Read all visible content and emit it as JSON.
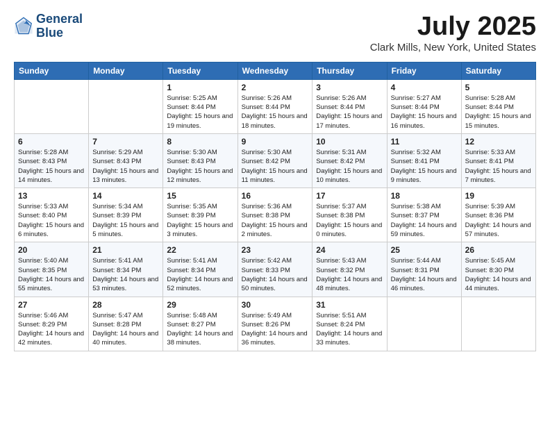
{
  "header": {
    "logo_line1": "General",
    "logo_line2": "Blue",
    "month_title": "July 2025",
    "location": "Clark Mills, New York, United States"
  },
  "weekdays": [
    "Sunday",
    "Monday",
    "Tuesday",
    "Wednesday",
    "Thursday",
    "Friday",
    "Saturday"
  ],
  "weeks": [
    [
      null,
      null,
      {
        "day": "1",
        "sunrise": "5:25 AM",
        "sunset": "8:44 PM",
        "daylight": "15 hours and 19 minutes."
      },
      {
        "day": "2",
        "sunrise": "5:26 AM",
        "sunset": "8:44 PM",
        "daylight": "15 hours and 18 minutes."
      },
      {
        "day": "3",
        "sunrise": "5:26 AM",
        "sunset": "8:44 PM",
        "daylight": "15 hours and 17 minutes."
      },
      {
        "day": "4",
        "sunrise": "5:27 AM",
        "sunset": "8:44 PM",
        "daylight": "15 hours and 16 minutes."
      },
      {
        "day": "5",
        "sunrise": "5:28 AM",
        "sunset": "8:44 PM",
        "daylight": "15 hours and 15 minutes."
      }
    ],
    [
      {
        "day": "6",
        "sunrise": "5:28 AM",
        "sunset": "8:43 PM",
        "daylight": "15 hours and 14 minutes."
      },
      {
        "day": "7",
        "sunrise": "5:29 AM",
        "sunset": "8:43 PM",
        "daylight": "15 hours and 13 minutes."
      },
      {
        "day": "8",
        "sunrise": "5:30 AM",
        "sunset": "8:43 PM",
        "daylight": "15 hours and 12 minutes."
      },
      {
        "day": "9",
        "sunrise": "5:30 AM",
        "sunset": "8:42 PM",
        "daylight": "15 hours and 11 minutes."
      },
      {
        "day": "10",
        "sunrise": "5:31 AM",
        "sunset": "8:42 PM",
        "daylight": "15 hours and 10 minutes."
      },
      {
        "day": "11",
        "sunrise": "5:32 AM",
        "sunset": "8:41 PM",
        "daylight": "15 hours and 9 minutes."
      },
      {
        "day": "12",
        "sunrise": "5:33 AM",
        "sunset": "8:41 PM",
        "daylight": "15 hours and 7 minutes."
      }
    ],
    [
      {
        "day": "13",
        "sunrise": "5:33 AM",
        "sunset": "8:40 PM",
        "daylight": "15 hours and 6 minutes."
      },
      {
        "day": "14",
        "sunrise": "5:34 AM",
        "sunset": "8:39 PM",
        "daylight": "15 hours and 5 minutes."
      },
      {
        "day": "15",
        "sunrise": "5:35 AM",
        "sunset": "8:39 PM",
        "daylight": "15 hours and 3 minutes."
      },
      {
        "day": "16",
        "sunrise": "5:36 AM",
        "sunset": "8:38 PM",
        "daylight": "15 hours and 2 minutes."
      },
      {
        "day": "17",
        "sunrise": "5:37 AM",
        "sunset": "8:38 PM",
        "daylight": "15 hours and 0 minutes."
      },
      {
        "day": "18",
        "sunrise": "5:38 AM",
        "sunset": "8:37 PM",
        "daylight": "14 hours and 59 minutes."
      },
      {
        "day": "19",
        "sunrise": "5:39 AM",
        "sunset": "8:36 PM",
        "daylight": "14 hours and 57 minutes."
      }
    ],
    [
      {
        "day": "20",
        "sunrise": "5:40 AM",
        "sunset": "8:35 PM",
        "daylight": "14 hours and 55 minutes."
      },
      {
        "day": "21",
        "sunrise": "5:41 AM",
        "sunset": "8:34 PM",
        "daylight": "14 hours and 53 minutes."
      },
      {
        "day": "22",
        "sunrise": "5:41 AM",
        "sunset": "8:34 PM",
        "daylight": "14 hours and 52 minutes."
      },
      {
        "day": "23",
        "sunrise": "5:42 AM",
        "sunset": "8:33 PM",
        "daylight": "14 hours and 50 minutes."
      },
      {
        "day": "24",
        "sunrise": "5:43 AM",
        "sunset": "8:32 PM",
        "daylight": "14 hours and 48 minutes."
      },
      {
        "day": "25",
        "sunrise": "5:44 AM",
        "sunset": "8:31 PM",
        "daylight": "14 hours and 46 minutes."
      },
      {
        "day": "26",
        "sunrise": "5:45 AM",
        "sunset": "8:30 PM",
        "daylight": "14 hours and 44 minutes."
      }
    ],
    [
      {
        "day": "27",
        "sunrise": "5:46 AM",
        "sunset": "8:29 PM",
        "daylight": "14 hours and 42 minutes."
      },
      {
        "day": "28",
        "sunrise": "5:47 AM",
        "sunset": "8:28 PM",
        "daylight": "14 hours and 40 minutes."
      },
      {
        "day": "29",
        "sunrise": "5:48 AM",
        "sunset": "8:27 PM",
        "daylight": "14 hours and 38 minutes."
      },
      {
        "day": "30",
        "sunrise": "5:49 AM",
        "sunset": "8:26 PM",
        "daylight": "14 hours and 36 minutes."
      },
      {
        "day": "31",
        "sunrise": "5:51 AM",
        "sunset": "8:24 PM",
        "daylight": "14 hours and 33 minutes."
      },
      null,
      null
    ]
  ]
}
